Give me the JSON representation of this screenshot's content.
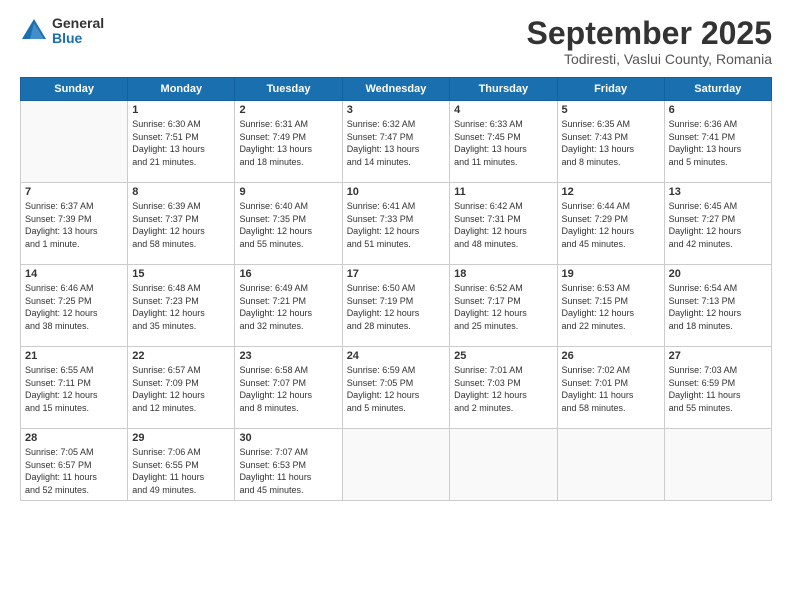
{
  "logo": {
    "general": "General",
    "blue": "Blue"
  },
  "header": {
    "month": "September 2025",
    "location": "Todiresti, Vaslui County, Romania"
  },
  "weekdays": [
    "Sunday",
    "Monday",
    "Tuesday",
    "Wednesday",
    "Thursday",
    "Friday",
    "Saturday"
  ],
  "weeks": [
    [
      {
        "day": "",
        "info": ""
      },
      {
        "day": "1",
        "info": "Sunrise: 6:30 AM\nSunset: 7:51 PM\nDaylight: 13 hours\nand 21 minutes."
      },
      {
        "day": "2",
        "info": "Sunrise: 6:31 AM\nSunset: 7:49 PM\nDaylight: 13 hours\nand 18 minutes."
      },
      {
        "day": "3",
        "info": "Sunrise: 6:32 AM\nSunset: 7:47 PM\nDaylight: 13 hours\nand 14 minutes."
      },
      {
        "day": "4",
        "info": "Sunrise: 6:33 AM\nSunset: 7:45 PM\nDaylight: 13 hours\nand 11 minutes."
      },
      {
        "day": "5",
        "info": "Sunrise: 6:35 AM\nSunset: 7:43 PM\nDaylight: 13 hours\nand 8 minutes."
      },
      {
        "day": "6",
        "info": "Sunrise: 6:36 AM\nSunset: 7:41 PM\nDaylight: 13 hours\nand 5 minutes."
      }
    ],
    [
      {
        "day": "7",
        "info": "Sunrise: 6:37 AM\nSunset: 7:39 PM\nDaylight: 13 hours\nand 1 minute."
      },
      {
        "day": "8",
        "info": "Sunrise: 6:39 AM\nSunset: 7:37 PM\nDaylight: 12 hours\nand 58 minutes."
      },
      {
        "day": "9",
        "info": "Sunrise: 6:40 AM\nSunset: 7:35 PM\nDaylight: 12 hours\nand 55 minutes."
      },
      {
        "day": "10",
        "info": "Sunrise: 6:41 AM\nSunset: 7:33 PM\nDaylight: 12 hours\nand 51 minutes."
      },
      {
        "day": "11",
        "info": "Sunrise: 6:42 AM\nSunset: 7:31 PM\nDaylight: 12 hours\nand 48 minutes."
      },
      {
        "day": "12",
        "info": "Sunrise: 6:44 AM\nSunset: 7:29 PM\nDaylight: 12 hours\nand 45 minutes."
      },
      {
        "day": "13",
        "info": "Sunrise: 6:45 AM\nSunset: 7:27 PM\nDaylight: 12 hours\nand 42 minutes."
      }
    ],
    [
      {
        "day": "14",
        "info": "Sunrise: 6:46 AM\nSunset: 7:25 PM\nDaylight: 12 hours\nand 38 minutes."
      },
      {
        "day": "15",
        "info": "Sunrise: 6:48 AM\nSunset: 7:23 PM\nDaylight: 12 hours\nand 35 minutes."
      },
      {
        "day": "16",
        "info": "Sunrise: 6:49 AM\nSunset: 7:21 PM\nDaylight: 12 hours\nand 32 minutes."
      },
      {
        "day": "17",
        "info": "Sunrise: 6:50 AM\nSunset: 7:19 PM\nDaylight: 12 hours\nand 28 minutes."
      },
      {
        "day": "18",
        "info": "Sunrise: 6:52 AM\nSunset: 7:17 PM\nDaylight: 12 hours\nand 25 minutes."
      },
      {
        "day": "19",
        "info": "Sunrise: 6:53 AM\nSunset: 7:15 PM\nDaylight: 12 hours\nand 22 minutes."
      },
      {
        "day": "20",
        "info": "Sunrise: 6:54 AM\nSunset: 7:13 PM\nDaylight: 12 hours\nand 18 minutes."
      }
    ],
    [
      {
        "day": "21",
        "info": "Sunrise: 6:55 AM\nSunset: 7:11 PM\nDaylight: 12 hours\nand 15 minutes."
      },
      {
        "day": "22",
        "info": "Sunrise: 6:57 AM\nSunset: 7:09 PM\nDaylight: 12 hours\nand 12 minutes."
      },
      {
        "day": "23",
        "info": "Sunrise: 6:58 AM\nSunset: 7:07 PM\nDaylight: 12 hours\nand 8 minutes."
      },
      {
        "day": "24",
        "info": "Sunrise: 6:59 AM\nSunset: 7:05 PM\nDaylight: 12 hours\nand 5 minutes."
      },
      {
        "day": "25",
        "info": "Sunrise: 7:01 AM\nSunset: 7:03 PM\nDaylight: 12 hours\nand 2 minutes."
      },
      {
        "day": "26",
        "info": "Sunrise: 7:02 AM\nSunset: 7:01 PM\nDaylight: 11 hours\nand 58 minutes."
      },
      {
        "day": "27",
        "info": "Sunrise: 7:03 AM\nSunset: 6:59 PM\nDaylight: 11 hours\nand 55 minutes."
      }
    ],
    [
      {
        "day": "28",
        "info": "Sunrise: 7:05 AM\nSunset: 6:57 PM\nDaylight: 11 hours\nand 52 minutes."
      },
      {
        "day": "29",
        "info": "Sunrise: 7:06 AM\nSunset: 6:55 PM\nDaylight: 11 hours\nand 49 minutes."
      },
      {
        "day": "30",
        "info": "Sunrise: 7:07 AM\nSunset: 6:53 PM\nDaylight: 11 hours\nand 45 minutes."
      },
      {
        "day": "",
        "info": ""
      },
      {
        "day": "",
        "info": ""
      },
      {
        "day": "",
        "info": ""
      },
      {
        "day": "",
        "info": ""
      }
    ]
  ]
}
